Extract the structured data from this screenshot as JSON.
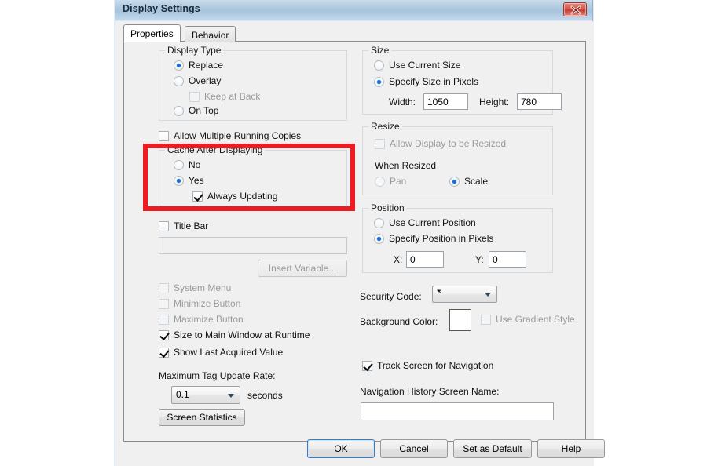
{
  "window": {
    "title": "Display Settings",
    "close_icon": "close-icon"
  },
  "tabs": [
    {
      "label": "Properties",
      "active": true
    },
    {
      "label": "Behavior",
      "active": false
    }
  ],
  "left_column": {
    "display_type": {
      "legend": "Display Type",
      "options": [
        {
          "label": "Replace",
          "selected": true,
          "disabled": false
        },
        {
          "label": "Overlay",
          "selected": false,
          "disabled": false
        },
        {
          "label": "On Top",
          "selected": false,
          "disabled": false
        }
      ],
      "keep_at_back": {
        "label": "Keep at Back",
        "checked": false,
        "disabled": true
      }
    },
    "allow_multiple_running_copies": {
      "label": "Allow Multiple Running Copies",
      "checked": false,
      "disabled": false
    },
    "cache_after_displaying": {
      "legend": "Cache After Displaying",
      "options": [
        {
          "label": "No",
          "selected": false
        },
        {
          "label": "Yes",
          "selected": true
        }
      ],
      "always_updating": {
        "label": "Always Updating",
        "checked": true
      }
    },
    "title_bar": {
      "label": "Title Bar",
      "checked": false
    },
    "title_bar_text": {
      "value": "",
      "disabled": true
    },
    "insert_variable_button": {
      "label": "Insert Variable...",
      "disabled": true
    },
    "checkboxes": [
      {
        "label": "System Menu",
        "checked": false,
        "disabled": true
      },
      {
        "label": "Minimize Button",
        "checked": false,
        "disabled": true
      },
      {
        "label": "Maximize Button",
        "checked": false,
        "disabled": true
      },
      {
        "label": "Size to Main Window at Runtime",
        "checked": true,
        "disabled": false
      },
      {
        "label": "Show Last Acquired Value",
        "checked": true,
        "disabled": false
      }
    ],
    "max_tag_update_rate": {
      "label": "Maximum Tag Update Rate:",
      "value": "0.1",
      "units": "seconds"
    },
    "screen_statistics_button": {
      "label": "Screen Statistics"
    }
  },
  "right_column": {
    "size": {
      "legend": "Size",
      "options": [
        {
          "label": "Use Current Size",
          "selected": false
        },
        {
          "label": "Specify Size in Pixels",
          "selected": true
        }
      ],
      "width": {
        "label": "Width:",
        "value": "1050"
      },
      "height": {
        "label": "Height:",
        "value": "780"
      }
    },
    "resize": {
      "legend": "Resize",
      "allow_resized": {
        "label": "Allow Display to be Resized",
        "checked": false,
        "disabled": true
      },
      "when_resized_label": "When Resized",
      "options": [
        {
          "label": "Pan",
          "selected": false,
          "disabled": true
        },
        {
          "label": "Scale",
          "selected": true,
          "disabled": false
        }
      ]
    },
    "position": {
      "legend": "Position",
      "options": [
        {
          "label": "Use Current Position",
          "selected": false
        },
        {
          "label": "Specify Position in Pixels",
          "selected": true
        }
      ],
      "x": {
        "label": "X:",
        "value": "0"
      },
      "y": {
        "label": "Y:",
        "value": "0"
      }
    },
    "security_code": {
      "label": "Security Code:",
      "value": "*"
    },
    "background_color": {
      "label": "Background Color:",
      "color": "#ffffff"
    },
    "use_gradient_style": {
      "label": "Use Gradient Style",
      "checked": false,
      "disabled": true
    },
    "track_screen_for_navigation": {
      "label": "Track Screen for Navigation",
      "checked": true
    },
    "navigation_history_screen_name": {
      "label": "Navigation History Screen Name:",
      "value": ""
    }
  },
  "footer_buttons": [
    {
      "label": "OK",
      "default": true
    },
    {
      "label": "Cancel",
      "default": false
    },
    {
      "label": "Set as Default",
      "default": false
    },
    {
      "label": "Help",
      "default": false
    }
  ],
  "annotation": {
    "color": "#ee1c22",
    "target": "cache-after-displaying-group"
  }
}
